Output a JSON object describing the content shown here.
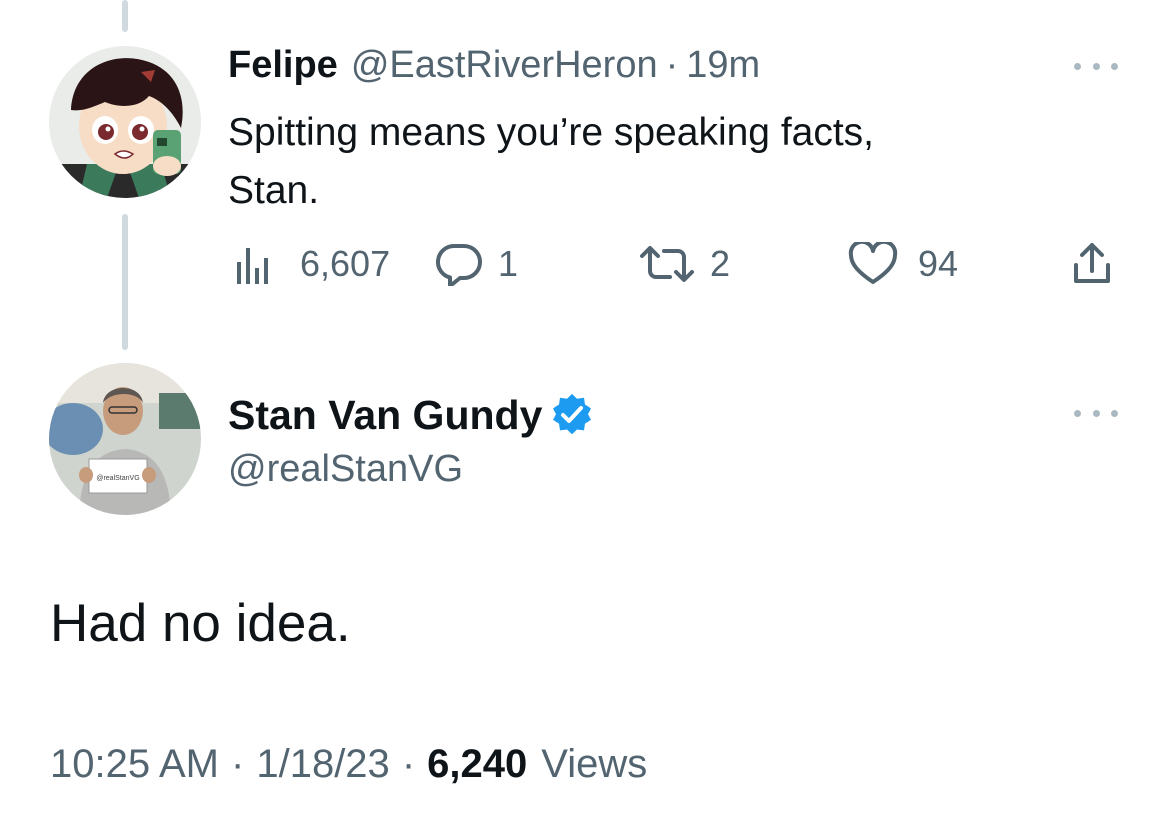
{
  "reply": {
    "display_name": "Felipe",
    "handle": "@EastRiverHeron",
    "separator": "·",
    "time": "19m",
    "text_line1": "Spitting means you’re speaking facts,",
    "text_line2": "Stan.",
    "views": "6,607",
    "replies": "1",
    "retweets": "2",
    "likes": "94"
  },
  "main_tweet": {
    "display_name": "Stan Van Gundy",
    "handle": "@realStanVG",
    "verified": true,
    "text": "Had no idea.",
    "time": "10:25 AM",
    "sep1": "·",
    "date": "1/18/23",
    "sep2": "·",
    "views_count": "6,240",
    "views_label": "Views",
    "avatar_sign_text": "@realStanVG"
  },
  "colors": {
    "text": "#0f1419",
    "secondary": "#536471",
    "verified": "#1d9bf0",
    "thread_line": "#cfd9de"
  },
  "icons": [
    "views-icon",
    "reply-icon",
    "retweet-icon",
    "like-icon",
    "share-icon",
    "verified-badge-icon",
    "more-icon"
  ]
}
